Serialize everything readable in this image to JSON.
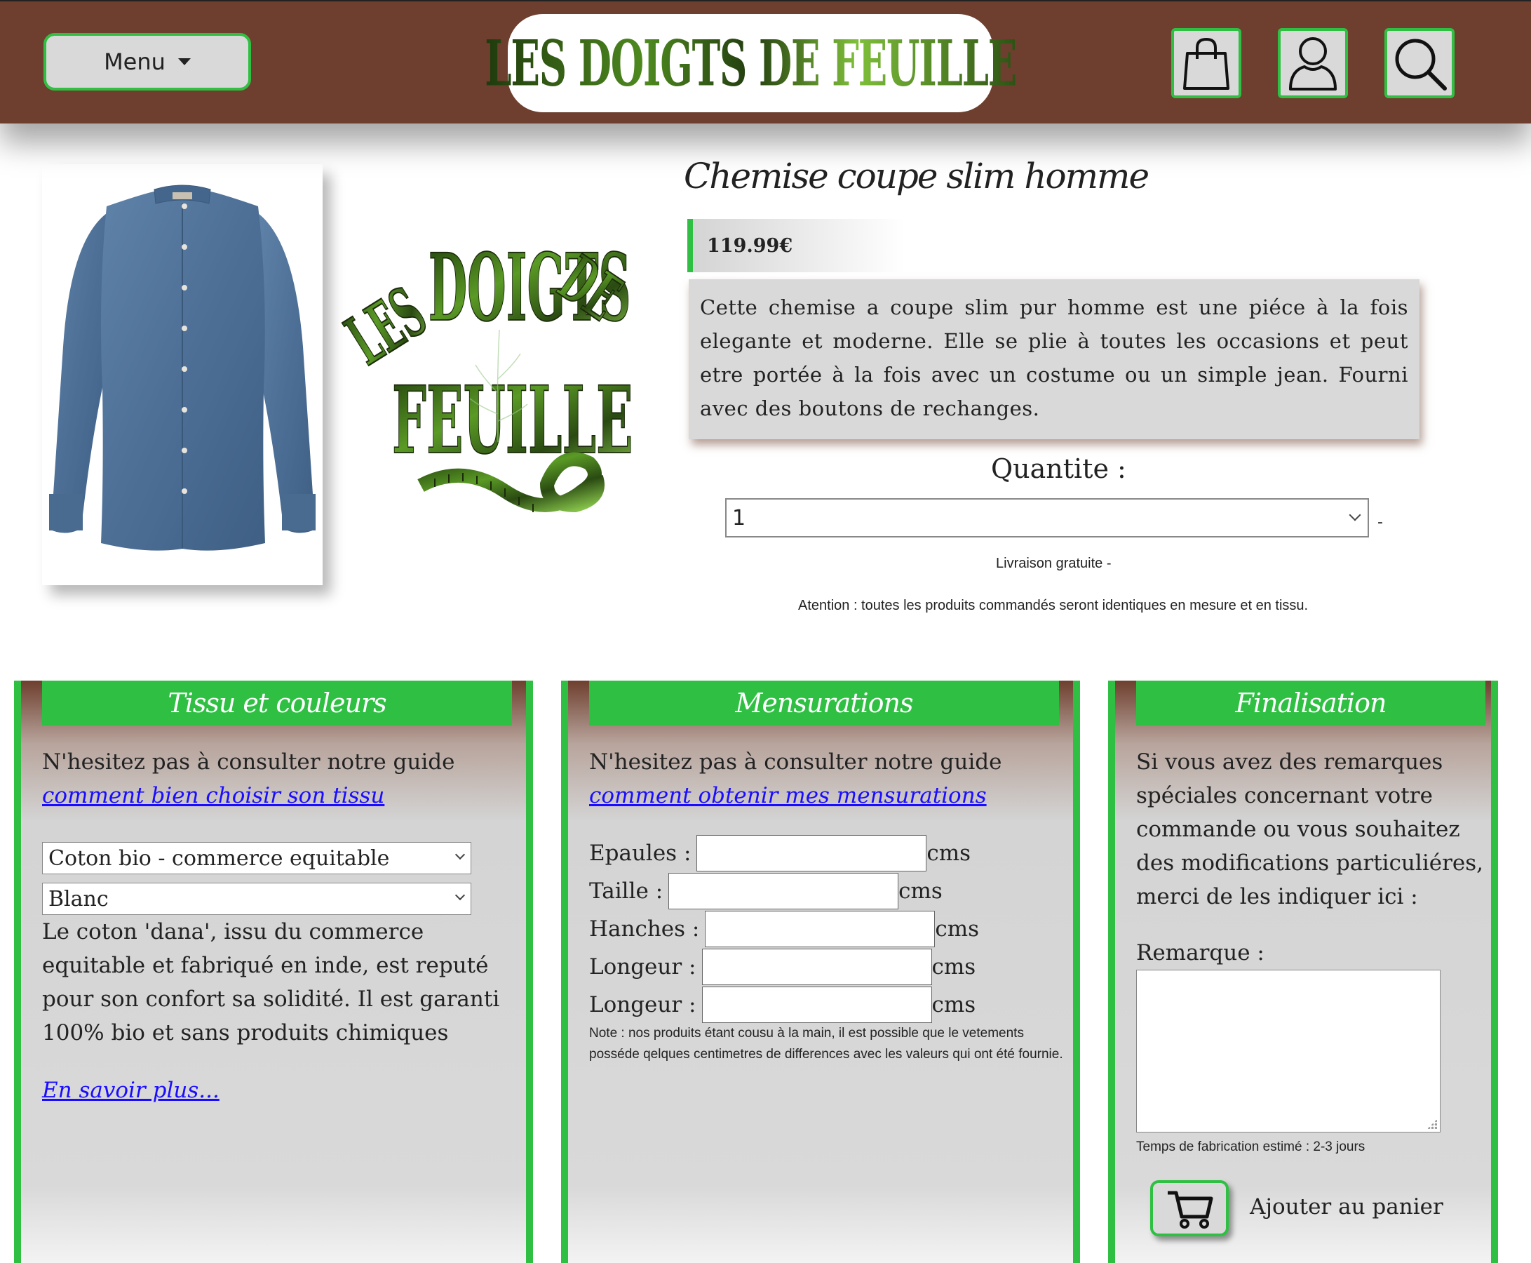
{
  "header": {
    "menu_label": "Menu",
    "logo_text": "LES DOIGTS DE FEUILLE",
    "icons": [
      "shopping-bag-icon",
      "user-icon",
      "search-icon"
    ]
  },
  "product": {
    "title": "Chemise coupe slim homme",
    "price": "119.99€",
    "description": "Cette chemise a coupe slim pur homme est une piéce à la fois elegante et moderne. Elle se plie à toutes les occasions et peut etre portée à la fois avec un costume ou un simple jean. Fourni avec des boutons de rechanges.",
    "quantity_label": "Quantite :",
    "quantity_value": "1",
    "quantity_suffix": "-",
    "delivery": "Livraison gratuite -",
    "warning": "Atention : toutes les produits commandés seront identiques en mesure et en tissu."
  },
  "fabric_panel": {
    "title": "Tissu et couleurs",
    "intro": "N'hesitez pas à consulter notre guide ",
    "guide_link": "comment bien choisir son tissu",
    "fabric_value": "Coton bio - commerce equitable",
    "color_value": "Blanc",
    "details": "Le coton 'dana', issu du commerce equitable et fabriqué en inde, est reputé pour son confort sa solidité. Il est garanti 100% bio et sans produits chimiques",
    "more_link": "En savoir plus..."
  },
  "measure_panel": {
    "title": "Mensurations",
    "intro": "N'hesitez pas à consulter notre guide ",
    "guide_link": "comment obtenir mes mensurations",
    "rows": [
      {
        "label": "Epaules :",
        "unit": "cms",
        "value": ""
      },
      {
        "label": "Taille :",
        "unit": "cms",
        "value": ""
      },
      {
        "label": "Hanches :",
        "unit": "cms",
        "value": ""
      },
      {
        "label": "Longeur :",
        "unit": "cms",
        "value": ""
      },
      {
        "label": "Longeur :",
        "unit": "cms",
        "value": ""
      }
    ],
    "note": "Note : nos produits étant cousu à la main, il est possible que le vetements posséde qelques centimetres de differences avec les valeurs qui ont été fournie."
  },
  "final_panel": {
    "title": "Finalisation",
    "intro": "Si vous avez des remarques spéciales concernant votre commande ou vous souhaitez des modifications particuliéres, merci de les indiquer ici :",
    "remark_label": "Remarque :",
    "remark_value": "",
    "fabrication_time": "Temps de fabrication estimé : 2-3 jours",
    "add_to_cart": "Ajouter au panier"
  },
  "colors": {
    "header_brown": "#6e3f2e",
    "accent_green": "#2fc043",
    "panel_grey": "#d9d9d9",
    "link_blue": "#1a0dff"
  }
}
